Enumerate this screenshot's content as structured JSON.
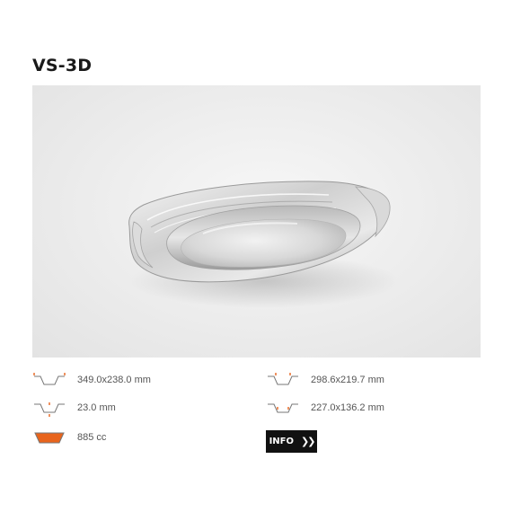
{
  "product": {
    "code": "VS-3D",
    "image_alt": "Oval aluminium foil platter"
  },
  "specs": {
    "top_dimensions": "349.0x238.0 mm",
    "bottom_dimensions": "298.6x219.7 mm",
    "depth": "23.0 mm",
    "inner_dimensions": "227.0x136.2 mm",
    "capacity": "885 cc"
  },
  "actions": {
    "info_label": "INFO",
    "info_chevron": "❯❯"
  },
  "colors": {
    "accent": "#e8641c",
    "icon_line": "#777777",
    "button_bg": "#111111"
  }
}
